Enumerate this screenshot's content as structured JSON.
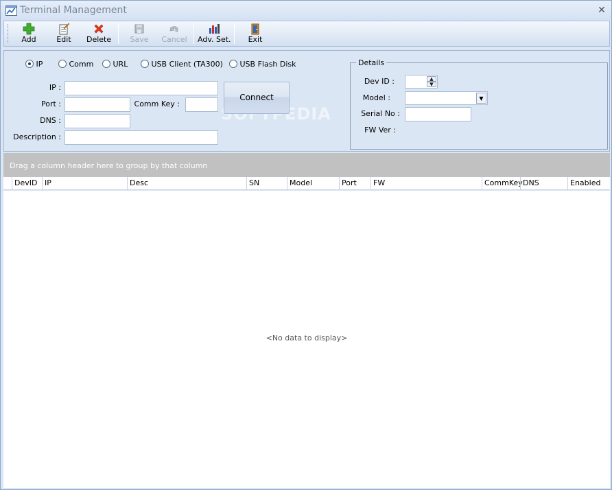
{
  "window": {
    "title": "Terminal Management"
  },
  "toolbar": {
    "add": "Add",
    "edit": "Edit",
    "delete": "Delete",
    "save": "Save",
    "cancel": "Cancel",
    "adv_set": "Adv. Set.",
    "exit": "Exit"
  },
  "connection": {
    "options": [
      "IP",
      "Comm",
      "URL",
      "USB Client (TA300)",
      "USB Flash Disk"
    ],
    "selected": "IP",
    "ip_label": "IP :",
    "port_label": "Port :",
    "comm_key_label": "Comm Key :",
    "dns_label": "DNS :",
    "description_label": "Description :",
    "ip_value": "",
    "port_value": "",
    "comm_key_value": "",
    "dns_value": "",
    "description_value": "",
    "connect_label": "Connect"
  },
  "details": {
    "legend": "Details",
    "dev_id_label": "Dev ID :",
    "model_label": "Model :",
    "serial_label": "Serial No :",
    "fw_label": "FW Ver :",
    "dev_id_value": "",
    "model_value": "",
    "serial_value": ""
  },
  "grid": {
    "group_hint": "Drag a column header here to group by that column",
    "columns": [
      "DevID",
      "IP",
      "Desc",
      "SN",
      "Model",
      "Port",
      "FW",
      "CommKey",
      "DNS",
      "Enabled"
    ],
    "empty_text": "<No data to display>"
  },
  "watermark": "SOFTPEDIA",
  "colors": {
    "window_bg": "#dbe6f4",
    "group_panel": "#c1c1c1",
    "title_text": "#7a8699"
  }
}
